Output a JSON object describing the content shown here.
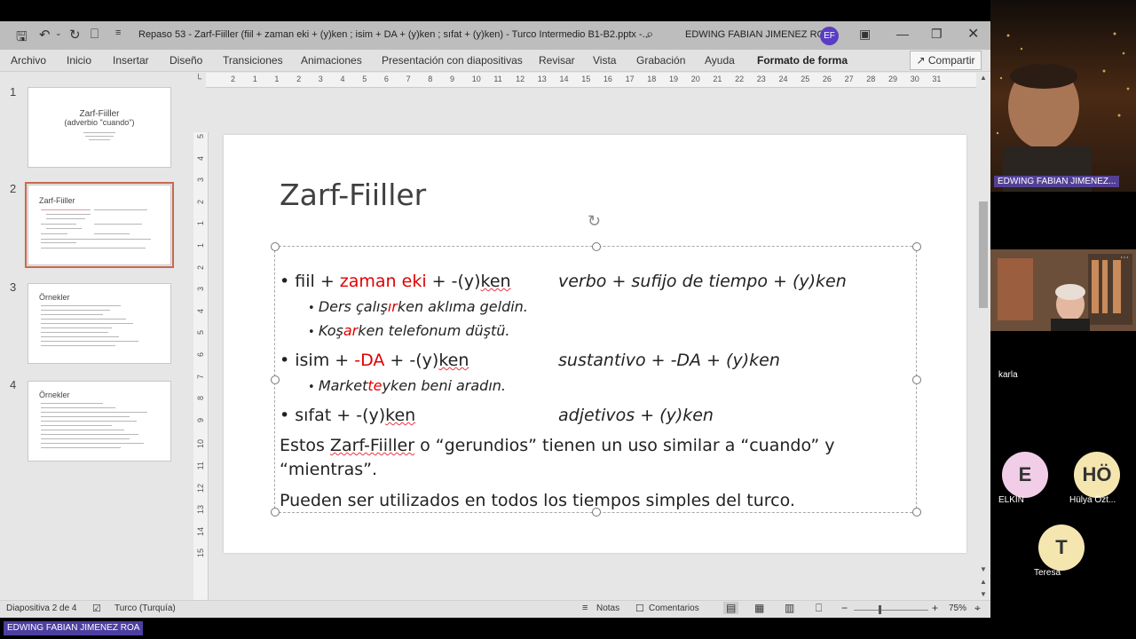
{
  "titlebar": {
    "doc_title": "Repaso 53 - Zarf-Fiiller (fiil + zaman eki + (y)ken ; isim + DA + (y)ken ; sıfat + (y)ken) - Turco Intermedio B1-B2.pptx  -...",
    "user_name": "EDWING FABIAN JIMENEZ ROA",
    "user_initials": "EF"
  },
  "ribbon": {
    "tabs": [
      "Archivo",
      "Inicio",
      "Insertar",
      "Diseño",
      "Transiciones",
      "Animaciones",
      "Presentación con diapositivas",
      "Revisar",
      "Vista",
      "Grabación",
      "Ayuda",
      "Formato de forma"
    ],
    "share_label": "Compartir"
  },
  "thumbnails": [
    {
      "num": "1",
      "title": "Zarf-Fiiller",
      "subtitle": "(adverbio \"cuando\")"
    },
    {
      "num": "2",
      "title": "Zarf-Fiiller"
    },
    {
      "num": "3",
      "title": "Örnekler"
    },
    {
      "num": "4",
      "title": "Örnekler"
    }
  ],
  "ruler": {
    "h": [
      "2",
      "1",
      "1",
      "2",
      "3",
      "4",
      "5",
      "6",
      "7",
      "8",
      "9",
      "10",
      "11",
      "12",
      "13",
      "14",
      "15",
      "16",
      "17",
      "18",
      "19",
      "20",
      "21",
      "22",
      "23",
      "24",
      "25",
      "26",
      "27",
      "28",
      "29",
      "30",
      "31"
    ],
    "v": [
      "5",
      "4",
      "3",
      "2",
      "1",
      "1",
      "2",
      "3",
      "4",
      "5",
      "6",
      "7",
      "8",
      "9",
      "10",
      "11",
      "12",
      "13",
      "14",
      "15"
    ]
  },
  "slide": {
    "title": "Zarf-Fiiller",
    "b1": {
      "pre": "fiil + ",
      "red": "zaman eki",
      "post": " + -(y)",
      "ul": "ken"
    },
    "b1_right": "verbo + sufijo de tiempo + (y)ken",
    "s1": {
      "pre": "Ders çalış",
      "red": "ır",
      "post": "ken aklıma geldin."
    },
    "s2": {
      "pre": "Koş",
      "red": "ar",
      "post": "ken telefonum düştü."
    },
    "b2": {
      "pre": "isim + ",
      "red": "-DA",
      "post": " + -(y)",
      "ul": "ken"
    },
    "b2_right": "sustantivo + -DA + (y)ken",
    "s3": {
      "pre": "Market",
      "red": "te",
      "post": "yken beni aradın."
    },
    "b3": {
      "pre": "sıfat + -(y)",
      "ul": "ken"
    },
    "b3_right": "adjetivos + (y)ken",
    "p1a": "Estos ",
    "p1u": "Zarf-Fiiller",
    "p1b": " o “gerundios” tienen un uso similar a “cuando” y",
    "p1c": "“mientras”.",
    "p2": "Pueden ser utilizados en todos los tiempos simples del turco."
  },
  "status": {
    "slide_of": "Diapositiva 2 de 4",
    "language": "Turco (Turquía)",
    "notes": "Notas",
    "comments": "Comentarios",
    "zoom": "75%"
  },
  "video": {
    "host_name": "EDWING FABIAN JIMENEZ...",
    "karla": "karla",
    "elkin": "ELKIN",
    "elkin_initial": "E",
    "hulya": "Hülya Özt...",
    "hulya_initial": "HÖ",
    "teresa": "Teresa",
    "teresa_initial": "T"
  },
  "share_banner": "EDWING FABIAN JIMENEZ ROA",
  "colors": {
    "accent": "#c8694d",
    "red": "#e00000",
    "avatar_bg": "#f5e6b0",
    "elkin_bg": "#f2cde8"
  }
}
